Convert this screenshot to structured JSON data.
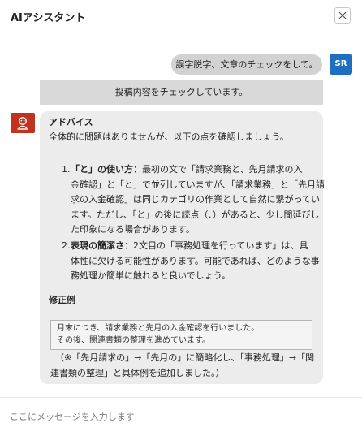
{
  "window": {
    "title": "AIアシスタント",
    "close_icon": "close-icon"
  },
  "conversation": {
    "user_message": "誤字脱字、文章のチェックをして。",
    "user_avatar": "SR",
    "status_message": "投稿内容をチェックしています。",
    "ai_response": {
      "heading": "アドバイス",
      "intro": "全体的に問題はありませんが、以下の点を確認しましょう。",
      "items": [
        {
          "number": "1.",
          "title": "「と」の使い方",
          "lines": [
            "：最初の文で「請求業務と、先月請求の入",
            "金確認」と「と」で並列していますが、「請求業務」と「先月請",
            "求の入金確認」は同じカテゴリの作業として自然に繋がってい",
            "ます。ただし、「と」の後に読点（、）があると、少し間延びし",
            "た印象になる場合があります。"
          ]
        },
        {
          "number": "2.",
          "title": "表現の簡潔さ",
          "lines": [
            "：2文目の「事務処理を行っています」は、具",
            "体性に欠ける可能性があります。可能であれば、どのような事",
            "務処理か簡単に触れると良いでしょう。"
          ]
        }
      ],
      "example_heading": "修正例",
      "example_lines": [
        "月末につき、請求業務と先月の入金確認を行いました。",
        "その後、関連書類の整理を進めています。"
      ],
      "note_lines": [
        "（※「先月請求の」→「先月の」に簡略化し、「事務処理」→「関",
        "連書類の整理」と具体例を追加しました。）"
      ]
    }
  },
  "input": {
    "placeholder": "ここにメッセージを入力します",
    "value": ""
  },
  "colors": {
    "user_avatar_bg": "#1f6fc1",
    "ai_avatar_bg": "#c0331f",
    "user_bubble_bg": "#d2d2d2",
    "status_bg": "#d9d9d9",
    "ai_bubble_bg": "#ececec"
  }
}
